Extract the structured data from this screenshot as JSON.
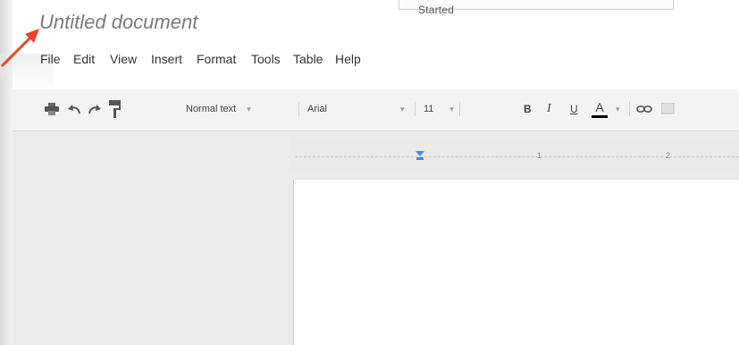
{
  "tooltip": {
    "text": "Started"
  },
  "document": {
    "title": "Untitled document"
  },
  "menu": [
    "File",
    "Edit",
    "View",
    "Insert",
    "Format",
    "Tools",
    "Table",
    "Help"
  ],
  "toolbar": {
    "style_select": "Normal text",
    "font_select": "Arial",
    "font_size": "11",
    "bold": "B",
    "italic": "I",
    "underline": "U",
    "text_color": "A",
    "caret": "▾",
    "icons": [
      "print-icon",
      "undo-icon",
      "redo-icon",
      "paint-format-icon",
      "link-icon",
      "comment-icon"
    ]
  },
  "ruler": {
    "labels": [
      "1",
      "2"
    ]
  },
  "colors": {
    "arrow": "#e8442a",
    "text_color_bar": "#000000",
    "ruler_marker": "#4a86e8"
  }
}
